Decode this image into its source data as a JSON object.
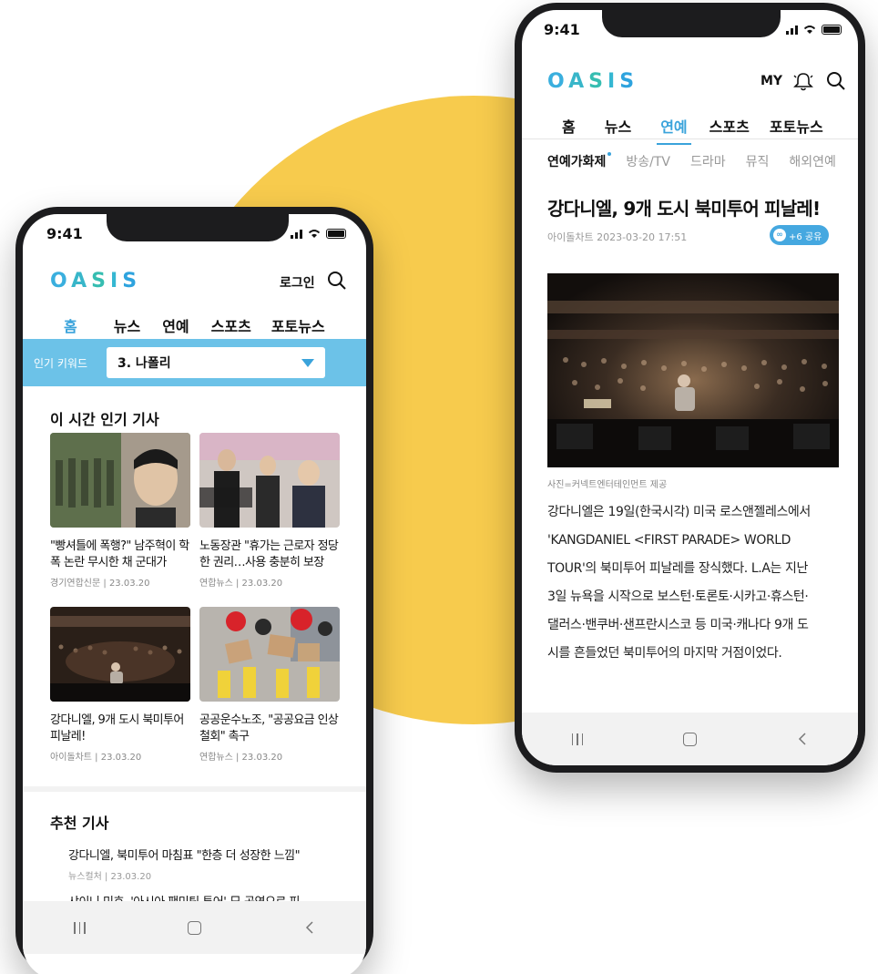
{
  "colors": {
    "accent": "#3AA3DB",
    "keyword_bar": "#6CC2E8",
    "background_circle": "#F7CB4D"
  },
  "left_phone": {
    "status_time": "9:41",
    "logo": [
      "O",
      "A",
      "S",
      "I",
      "S"
    ],
    "header": {
      "login": "로그인",
      "search_icon": "search-icon"
    },
    "tabs": [
      {
        "label": "홈",
        "active": true
      },
      {
        "label": "뉴스"
      },
      {
        "label": "연예"
      },
      {
        "label": "스포츠"
      },
      {
        "label": "포토뉴스"
      }
    ],
    "keyword": {
      "label": "인기 키워드",
      "selected": "3. 나폴리"
    },
    "popular_title": "이 시간 인기 기사",
    "cards": [
      {
        "title": "\"빵셔틀에 폭행?\" 남주혁이 학폭 논란 무시한 채 군대가",
        "source": "경기연합신문",
        "date": "23.03.20"
      },
      {
        "title": "노동장관 \"휴가는 근로자 정당한 권리…사용 충분히 보장",
        "source": "연합뉴스",
        "date": "23.03.20"
      },
      {
        "title": "강다니엘, 9개 도시 북미투어 피날레!",
        "source": "아이돌차트",
        "date": "23.03.20"
      },
      {
        "title": "공공운수노조, \"공공요금 인상 철회\" 촉구",
        "source": "연합뉴스",
        "date": "23.03.20"
      }
    ],
    "recommend_title": "추천 기사",
    "recommend": [
      {
        "title": "강다니엘, 북미투어 마침표 \"한층 더 성장한 느낌\"",
        "meta": "뉴스컬처 | 23.03.20"
      },
      {
        "title": "샤이니 민호, '아시아 팬미팅 투어' 日 공연으로 피..."
      }
    ]
  },
  "right_phone": {
    "status_time": "9:41",
    "logo": [
      "O",
      "A",
      "S",
      "I",
      "S"
    ],
    "header": {
      "my": "MY"
    },
    "tabs": [
      {
        "label": "홈"
      },
      {
        "label": "뉴스"
      },
      {
        "label": "연예",
        "active": true
      },
      {
        "label": "스포츠"
      },
      {
        "label": "포토뉴스"
      }
    ],
    "subtabs": [
      {
        "label": "연예가화제",
        "active": true
      },
      {
        "label": "방송/TV"
      },
      {
        "label": "드라마"
      },
      {
        "label": "뮤직"
      },
      {
        "label": "해외연예"
      }
    ],
    "article": {
      "title": "강다니엘, 9개 도시 북미투어 피날레!",
      "meta": "아이돌차트 2023-03-20 17:51",
      "share": "+6 공유",
      "caption": "사진=커넥트엔터테인먼트 제공",
      "body_lines": [
        "강다니엘은 19일(한국시각) 미국 로스앤젤레스에서",
        "'KANGDANIEL <FIRST PARADE> WORLD",
        "TOUR'의 북미투어 피날레를 장식했다. L.A는 지난",
        "3일 뉴욕을 시작으로 보스턴·토론토·시카고·휴스턴·",
        "댈러스·밴쿠버·샌프란시스코 등 미국·캐나다 9개 도",
        "시를 흔들었던 북미투어의 마지막 거점이었다."
      ]
    }
  }
}
